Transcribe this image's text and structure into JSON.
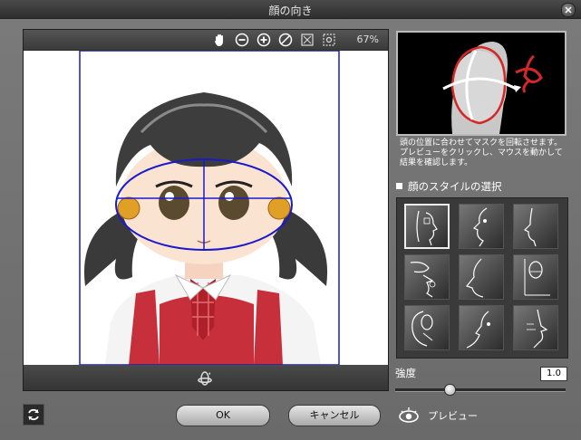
{
  "window": {
    "title": "顔の向き"
  },
  "canvas": {
    "zoom": "67%"
  },
  "tools": [
    "hand-tool-icon",
    "zoom-out-icon",
    "zoom-in-icon",
    "no-symbol-icon",
    "fit-window-icon",
    "fit-selection-icon"
  ],
  "panel": {
    "description_lines": [
      "頭の位置に合わせてマスクを回転させます。",
      "プレビューをクリックし、マウスを動かして",
      "結果を確認します。"
    ],
    "style_section_title": "顔のスタイルの選択",
    "strength_label": "強度",
    "strength_value": "1.0",
    "strength_fraction": 0.32
  },
  "buttons": {
    "ok": "OK",
    "cancel": "キャンセル",
    "preview": "プレビュー"
  },
  "colors": {
    "guide": "#1a1acc",
    "accent_red": "#d42828",
    "skin": "#fbe3d2"
  }
}
